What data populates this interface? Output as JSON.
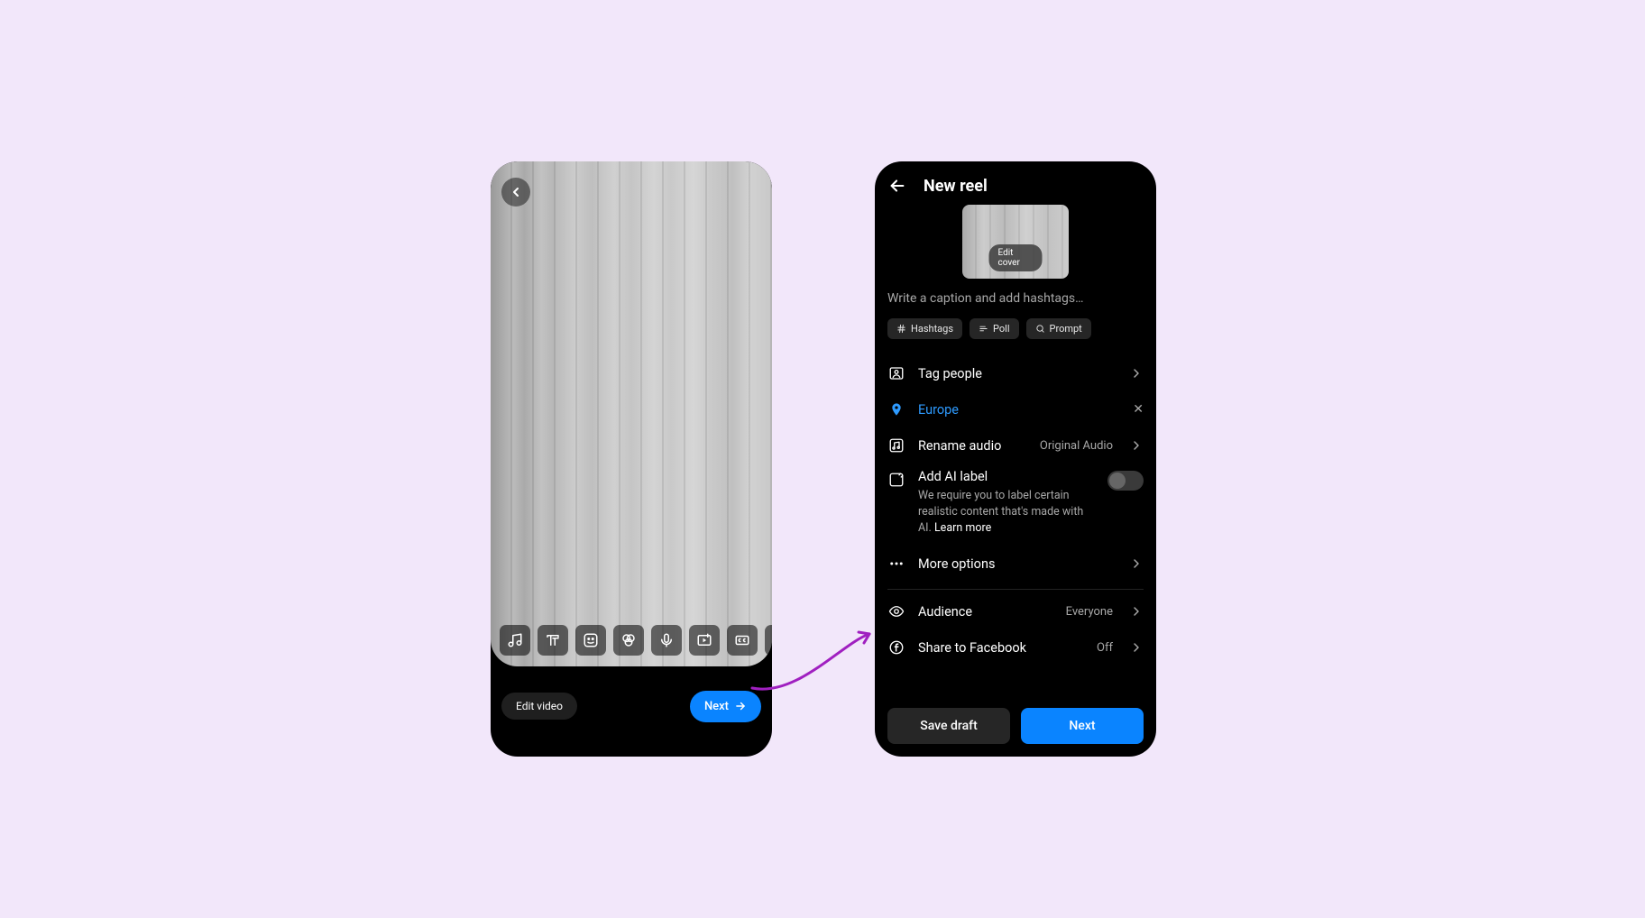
{
  "left": {
    "edit_video_label": "Edit video",
    "next_label": "Next"
  },
  "right": {
    "title": "New reel",
    "edit_cover_label": "Edit cover",
    "caption_placeholder": "Write a caption and add hashtags…",
    "chips": {
      "hashtags": "Hashtags",
      "poll": "Poll",
      "prompt": "Prompt"
    },
    "rows": {
      "tag_people": "Tag people",
      "location_value": "Europe",
      "rename_audio": "Rename audio",
      "rename_audio_value": "Original Audio",
      "ai_title": "Add AI label",
      "ai_desc": "We require you to label certain realistic content that's made with AI. ",
      "ai_learn": "Learn more",
      "more_options": "More options",
      "audience": "Audience",
      "audience_value": "Everyone",
      "share_fb": "Share to Facebook",
      "share_fb_value": "Off"
    },
    "footer": {
      "save_draft": "Save draft",
      "next": "Next"
    }
  }
}
